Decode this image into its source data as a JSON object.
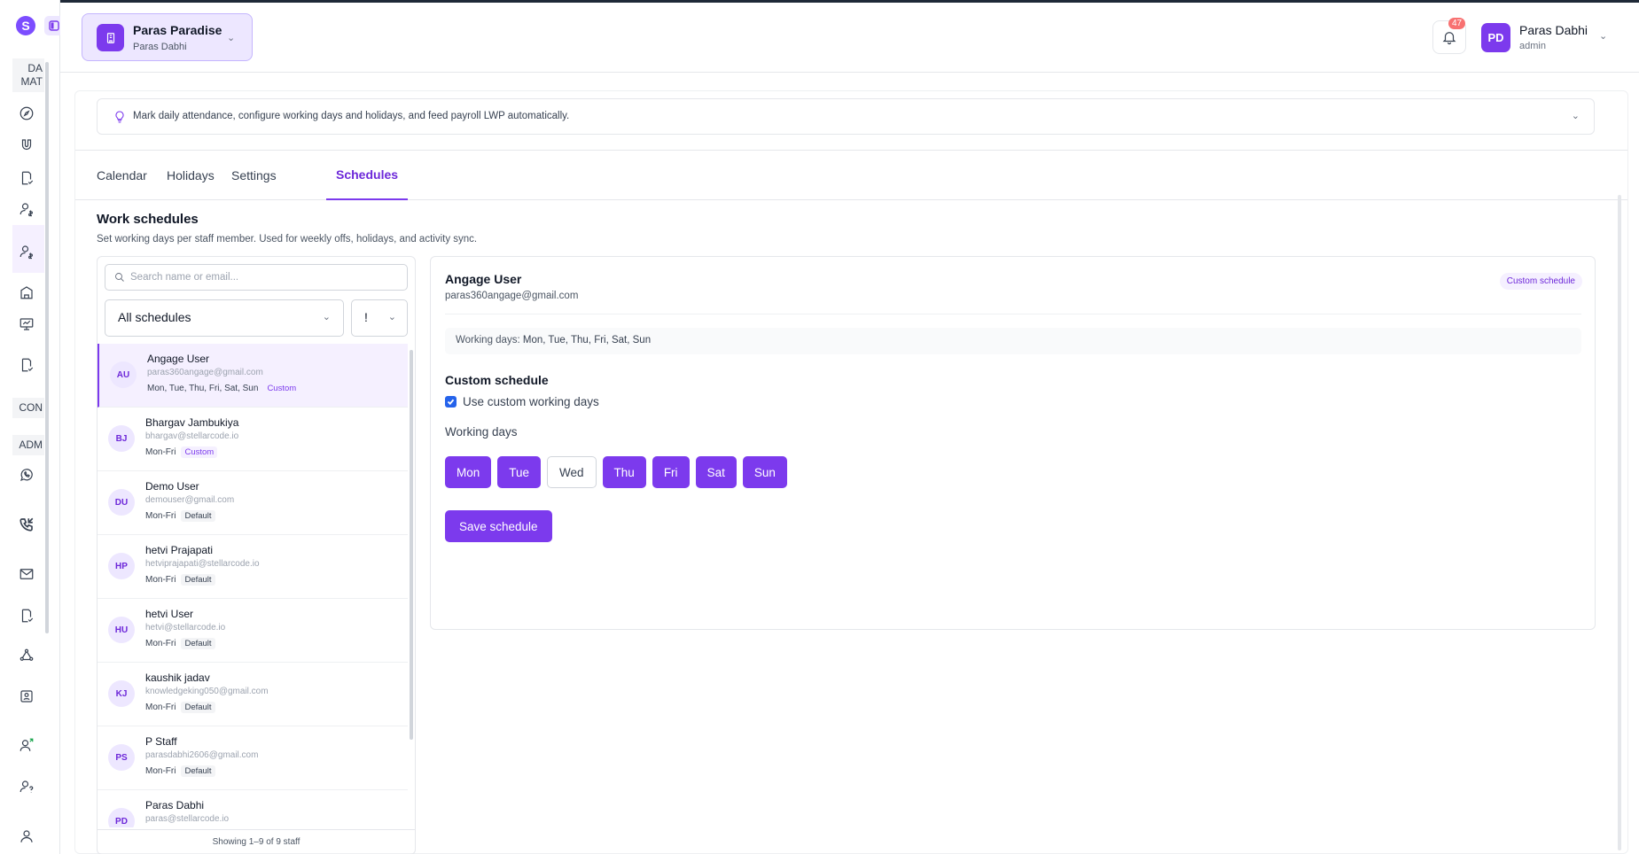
{
  "sidebar": {
    "logo_letter": "S",
    "sections": [
      {
        "label": "DA\nMAT"
      },
      {
        "label": "CON"
      },
      {
        "label": "ADM"
      }
    ]
  },
  "header": {
    "org_name": "Paras Paradise",
    "org_owner": "Paras Dabhi",
    "notifications_count": "47",
    "user_initials": "PD",
    "user_name": "Paras Dabhi",
    "user_role": "admin"
  },
  "hint": {
    "text": "Mark daily attendance, configure working days and holidays, and feed payroll LWP automatically."
  },
  "tabs": [
    "Calendar",
    "Holidays",
    "Settings",
    "Schedules"
  ],
  "active_tab": "Schedules",
  "work_schedules": {
    "title": "Work schedules",
    "subtitle": "Set working days per staff member. Used for weekly offs, holidays, and activity sync."
  },
  "list": {
    "search_placeholder": "Search name or email...",
    "filter_value": "All schedules",
    "filter2_value": "!",
    "footer": "Showing 1–9 of 9 staff",
    "staff": [
      {
        "initials": "AU",
        "name": "Angage User",
        "email": "paras360angage@gmail.com",
        "days": "Mon, Tue, Thu, Fri, Sat, Sun",
        "tag": "Custom",
        "tag_type": "custom",
        "selected": true
      },
      {
        "initials": "BJ",
        "name": "Bhargav Jambukiya",
        "email": "bhargav@stellarcode.io",
        "days": "Mon-Fri",
        "tag": "Custom",
        "tag_type": "custom",
        "selected": false
      },
      {
        "initials": "DU",
        "name": "Demo User",
        "email": "demouser@gmail.com",
        "days": "Mon-Fri",
        "tag": "Default",
        "tag_type": "default",
        "selected": false
      },
      {
        "initials": "HP",
        "name": "hetvi Prajapati",
        "email": "hetviprajapati@stellarcode.io",
        "days": "Mon-Fri",
        "tag": "Default",
        "tag_type": "default",
        "selected": false
      },
      {
        "initials": "HU",
        "name": "hetvi User",
        "email": "hetvi@stellarcode.io",
        "days": "Mon-Fri",
        "tag": "Default",
        "tag_type": "default",
        "selected": false
      },
      {
        "initials": "KJ",
        "name": "kaushik jadav",
        "email": "knowledgeking050@gmail.com",
        "days": "Mon-Fri",
        "tag": "Default",
        "tag_type": "default",
        "selected": false
      },
      {
        "initials": "PS",
        "name": "P Staff",
        "email": "parasdabhi2606@gmail.com",
        "days": "Mon-Fri",
        "tag": "Default",
        "tag_type": "default",
        "selected": false
      },
      {
        "initials": "PD",
        "name": "Paras Dabhi",
        "email": "paras@stellarcode.io",
        "days": "",
        "tag": "",
        "tag_type": "",
        "selected": false
      }
    ]
  },
  "detail": {
    "name": "Angage User",
    "email": "paras360angage@gmail.com",
    "badge": "Custom schedule",
    "working_days_label": "Working days:",
    "working_days_value": "Mon, Tue, Thu, Fri, Sat, Sun",
    "custom_title": "Custom schedule",
    "checkbox_label": "Use custom working days",
    "checkbox_checked": true,
    "working_days_title": "Working days",
    "days": [
      {
        "label": "Mon",
        "on": true
      },
      {
        "label": "Tue",
        "on": true
      },
      {
        "label": "Wed",
        "on": false
      },
      {
        "label": "Thu",
        "on": true
      },
      {
        "label": "Fri",
        "on": true
      },
      {
        "label": "Sat",
        "on": true
      },
      {
        "label": "Sun",
        "on": true
      }
    ],
    "save_label": "Save schedule"
  },
  "colors": {
    "accent": "#7c3aed",
    "accent_light": "#ede7ff",
    "border": "#e5e7eb"
  }
}
